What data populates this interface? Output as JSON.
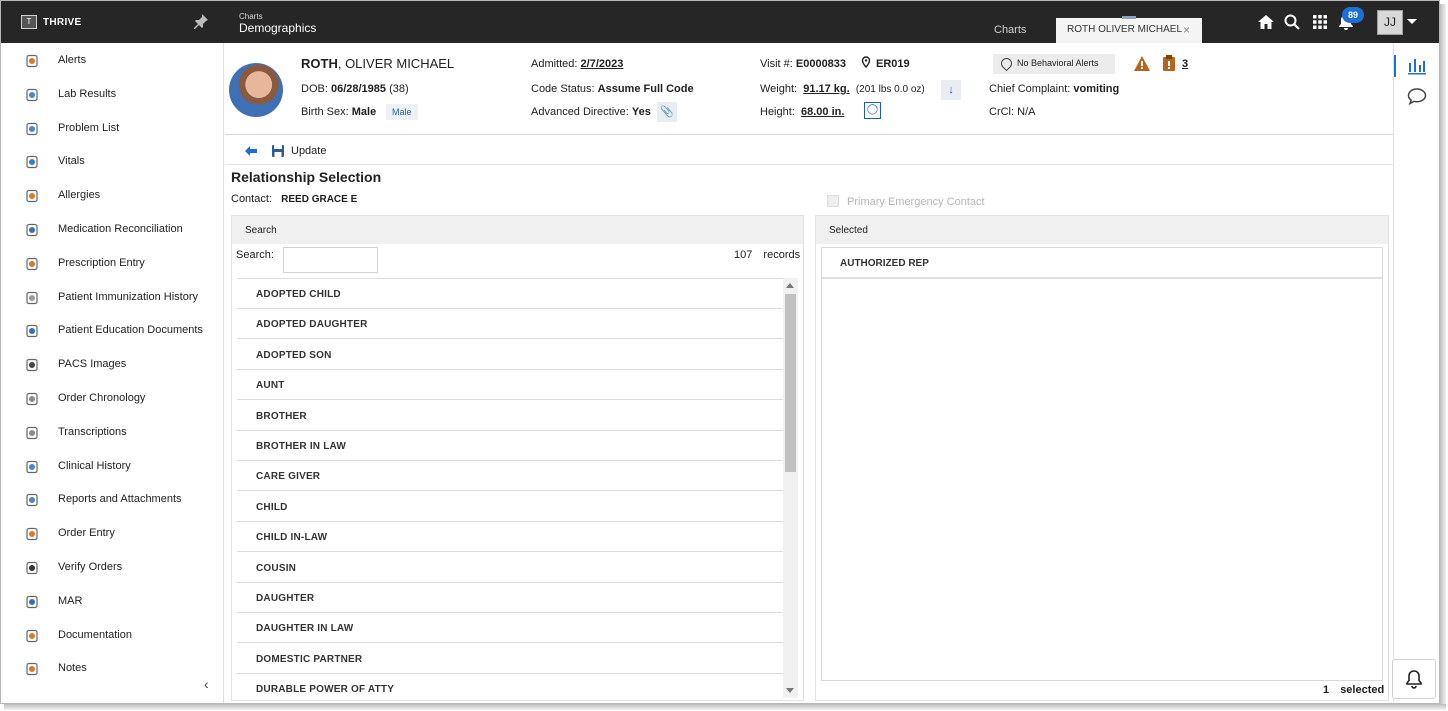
{
  "topbar": {
    "logo_text": "T",
    "brand": "THRIVE",
    "crumb_small": "Charts",
    "crumb_title": "Demographics",
    "tab_charts": "Charts",
    "tab_patient": "ROTH OLIVER MICHAEL",
    "tab_close": "×",
    "notification_count": "89",
    "user_initials": "JJ"
  },
  "sidebar": {
    "items": [
      {
        "label": "Alerts",
        "icon": "alerts-icon",
        "color": "#d87a2a"
      },
      {
        "label": "Lab Results",
        "icon": "lab-flask-icon",
        "color": "#4a86c8"
      },
      {
        "label": "Problem List",
        "icon": "problem-list-icon",
        "color": "#4a86c8"
      },
      {
        "label": "Vitals",
        "icon": "vitals-icon",
        "color": "#2f7fc9"
      },
      {
        "label": "Allergies",
        "icon": "allergies-icon",
        "color": "#e07a2a"
      },
      {
        "label": "Medication Reconciliation",
        "icon": "med-reconciliation-icon",
        "color": "#3a6fb0"
      },
      {
        "label": "Prescription Entry",
        "icon": "prescription-icon",
        "color": "#d07a2a"
      },
      {
        "label": "Patient Immunization History",
        "icon": "immunization-icon",
        "color": "#9a9a9a"
      },
      {
        "label": "Patient Education Documents",
        "icon": "education-icon",
        "color": "#3a6fb0"
      },
      {
        "label": "PACS Images",
        "icon": "pacs-images-icon",
        "color": "#444444"
      },
      {
        "label": "Order Chronology",
        "icon": "order-chronology-icon",
        "color": "#8a8a8a"
      },
      {
        "label": "Transcriptions",
        "icon": "transcriptions-icon",
        "color": "#8a8a8a"
      },
      {
        "label": "Clinical History",
        "icon": "clinical-history-icon",
        "color": "#4a86c8"
      },
      {
        "label": "Reports and Attachments",
        "icon": "attachments-icon",
        "color": "#4a86c8"
      },
      {
        "label": "Order Entry",
        "icon": "order-entry-icon",
        "color": "#d87a2a"
      },
      {
        "label": "Verify Orders",
        "icon": "verify-orders-icon",
        "color": "#333333"
      },
      {
        "label": "MAR",
        "icon": "mar-icon",
        "color": "#3a6fb0"
      },
      {
        "label": "Documentation",
        "icon": "documentation-icon",
        "color": "#d87a2a"
      },
      {
        "label": "Notes",
        "icon": "notes-icon",
        "color": "#d87a2a"
      }
    ],
    "collapse_glyph": "‹"
  },
  "patient": {
    "last_name": "ROTH",
    "rest_name": ", OLIVER MICHAEL",
    "dob_label": "DOB:",
    "dob": "06/28/1985",
    "age": "(38)",
    "sex_label": "Birth Sex:",
    "sex": "Male",
    "sex_chip": "Male",
    "admitted_label": "Admitted:",
    "admitted": "2/7/2023",
    "code_label": "Code Status:",
    "code": "Assume Full Code",
    "adv_label": "Advanced Directive:",
    "adv": "Yes",
    "visit_label": "Visit #:",
    "visit": "E0000833",
    "location": "ER019",
    "weight_label": "Weight:",
    "weight": "91.17 kg.",
    "weight_lbs": "(201 lbs 0.0 oz)",
    "height_label": "Height:",
    "height": "68.00 in.",
    "behavioral": "No Behavioral Alerts",
    "alert_count": "3",
    "complaint_label": "Chief Complaint:",
    "complaint": "vomiting",
    "crcl_label": "CrCl:",
    "crcl": "N/A"
  },
  "toolbar": {
    "update_label": "Update"
  },
  "main": {
    "title": "Relationship Selection",
    "contact_label": "Contact:",
    "contact_name": "REED GRACE E",
    "primary_emergency": "Primary Emergency Contact",
    "search_panel_title": "Search",
    "search_label": "Search:",
    "search_value": "",
    "record_count": "107",
    "records_label": "records",
    "relationships": [
      "ADOPTED CHILD",
      "ADOPTED DAUGHTER",
      "ADOPTED SON",
      "AUNT",
      "BROTHER",
      "BROTHER IN LAW",
      "CARE GIVER",
      "CHILD",
      "CHILD IN-LAW",
      "COUSIN",
      "DAUGHTER",
      "DAUGHTER IN LAW",
      "DOMESTIC PARTNER",
      "DURABLE POWER OF ATTY"
    ],
    "selected_panel_title": "Selected",
    "selected_items": [
      "AUTHORIZED REP"
    ],
    "selected_count": "1",
    "selected_label": "selected"
  },
  "colors": {
    "topbar": "#262626",
    "accent": "#1d6fd8",
    "alert_orange": "#b5651d"
  }
}
